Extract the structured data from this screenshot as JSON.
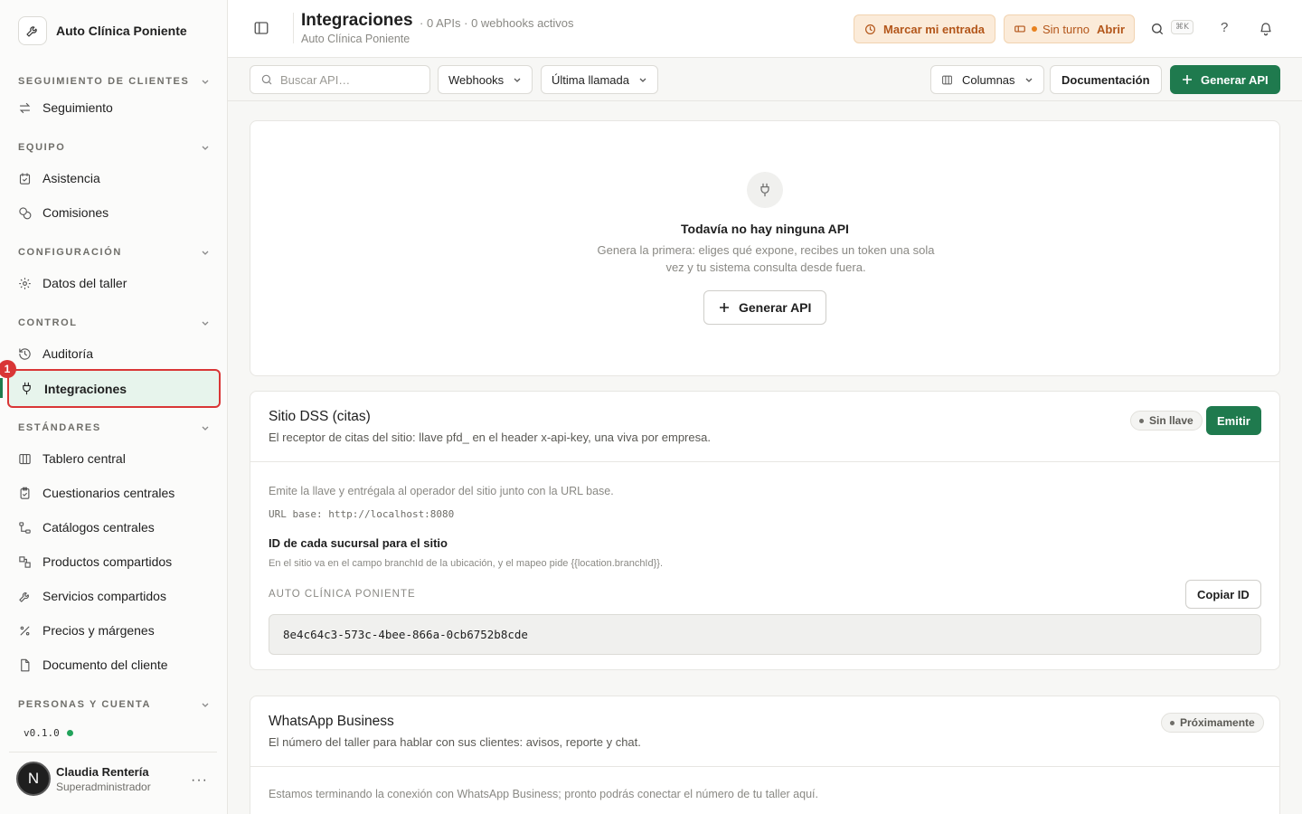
{
  "sidebar": {
    "brand_name": "Auto Clínica Poniente",
    "sections": {
      "seguimiento": "SEGUIMIENTO DE CLIENTES",
      "equipo": "EQUIPO",
      "configuracion": "CONFIGURACIÓN",
      "control": "CONTROL",
      "estandares": "ESTÁNDARES",
      "personas": "PERSONAS Y CUENTA"
    },
    "items": {
      "seguimiento": "Seguimiento",
      "asistencia": "Asistencia",
      "comisiones": "Comisiones",
      "datos_taller": "Datos del taller",
      "auditoria": "Auditoría",
      "integraciones": "Integraciones",
      "tablero": "Tablero central",
      "cuestionarios": "Cuestionarios centrales",
      "catalogos": "Catálogos centrales",
      "productos": "Productos compartidos",
      "servicios": "Servicios compartidos",
      "precios": "Precios y márgenes",
      "documento": "Documento del cliente"
    },
    "active_badge": "1",
    "version": "v0.1.0",
    "user": {
      "initial": "N",
      "name": "Claudia Rentería",
      "role": "Superadministrador",
      "more": "···"
    }
  },
  "header": {
    "title": "Integraciones",
    "subtitle": "Auto Clínica Poniente",
    "meta": "· 0 APIs · 0 webhooks activos",
    "clock_in": "Marcar mi entrada",
    "shift_status": "Sin turno",
    "shift_open": "Abrir",
    "shortcut": "⌘K",
    "help": "?"
  },
  "toolbar": {
    "search_placeholder": "Buscar API…",
    "filter_webhooks": "Webhooks",
    "filter_last_call": "Última llamada",
    "columns": "Columnas",
    "docs": "Documentación",
    "generate_api": "Generar API"
  },
  "empty_state": {
    "title": "Todavía no hay ninguna API",
    "description": "Genera la primera: eliges qué expone, recibes un token una sola vez y tu sistema consulta desde fuera.",
    "button": "Generar API"
  },
  "dss": {
    "title": "Sitio DSS (citas)",
    "description": "El receptor de citas del sitio: llave pfd_ en el header x-api-key, una viva por empresa.",
    "status": "Sin llave",
    "emit": "Emitir",
    "intro": "Emite la llave y entrégala al operador del sitio junto con la URL base.",
    "base_url": "URL base: http://localhost:8080",
    "id_title": "ID de cada sucursal para el sitio",
    "id_note": "En el sitio va en el campo branchId de la ubicación, y el mapeo pide {{location.branchId}}.",
    "branch_label": "AUTO CLÍNICA PONIENTE",
    "copy": "Copiar ID",
    "branch_id": "8e4c64c3-573c-4bee-866a-0cb6752b8cde"
  },
  "whatsapp": {
    "title": "WhatsApp Business",
    "description": "El número del taller para hablar con sus clientes: avisos, reporte y chat.",
    "status": "Próximamente",
    "body": "Estamos terminando la conexión con WhatsApp Business; pronto podrás conectar el número de tu taller aquí."
  },
  "colors": {
    "accent_green": "#1f7a4e",
    "active_bg": "#e7f4ec",
    "highlight_red": "#d93636",
    "warning_bg": "#fbebd9",
    "warning_text": "#b3561a"
  }
}
